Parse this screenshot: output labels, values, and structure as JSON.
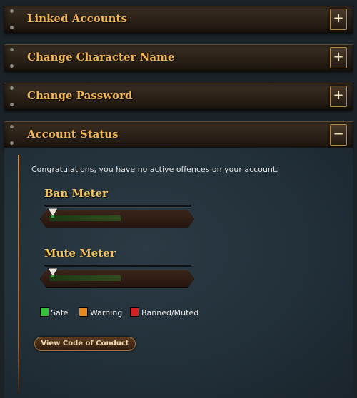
{
  "sections": [
    {
      "title": "Linked Accounts",
      "toggle": "+"
    },
    {
      "title": "Change Character Name",
      "toggle": "+"
    },
    {
      "title": "Change Password",
      "toggle": "+"
    },
    {
      "title": "Account Status",
      "toggle": "−"
    }
  ],
  "account_status": {
    "message": "Congratulations, you have no active offences on your account.",
    "ban_meter": {
      "title": "Ban Meter",
      "level": 0
    },
    "mute_meter": {
      "title": "Mute Meter",
      "level": 0
    },
    "legend": [
      {
        "label": "Safe",
        "color": "#36c13a"
      },
      {
        "label": "Warning",
        "color": "#e5891d"
      },
      {
        "label": "Banned/Muted",
        "color": "#d42020"
      }
    ],
    "conduct_button": "View Code of Conduct"
  }
}
